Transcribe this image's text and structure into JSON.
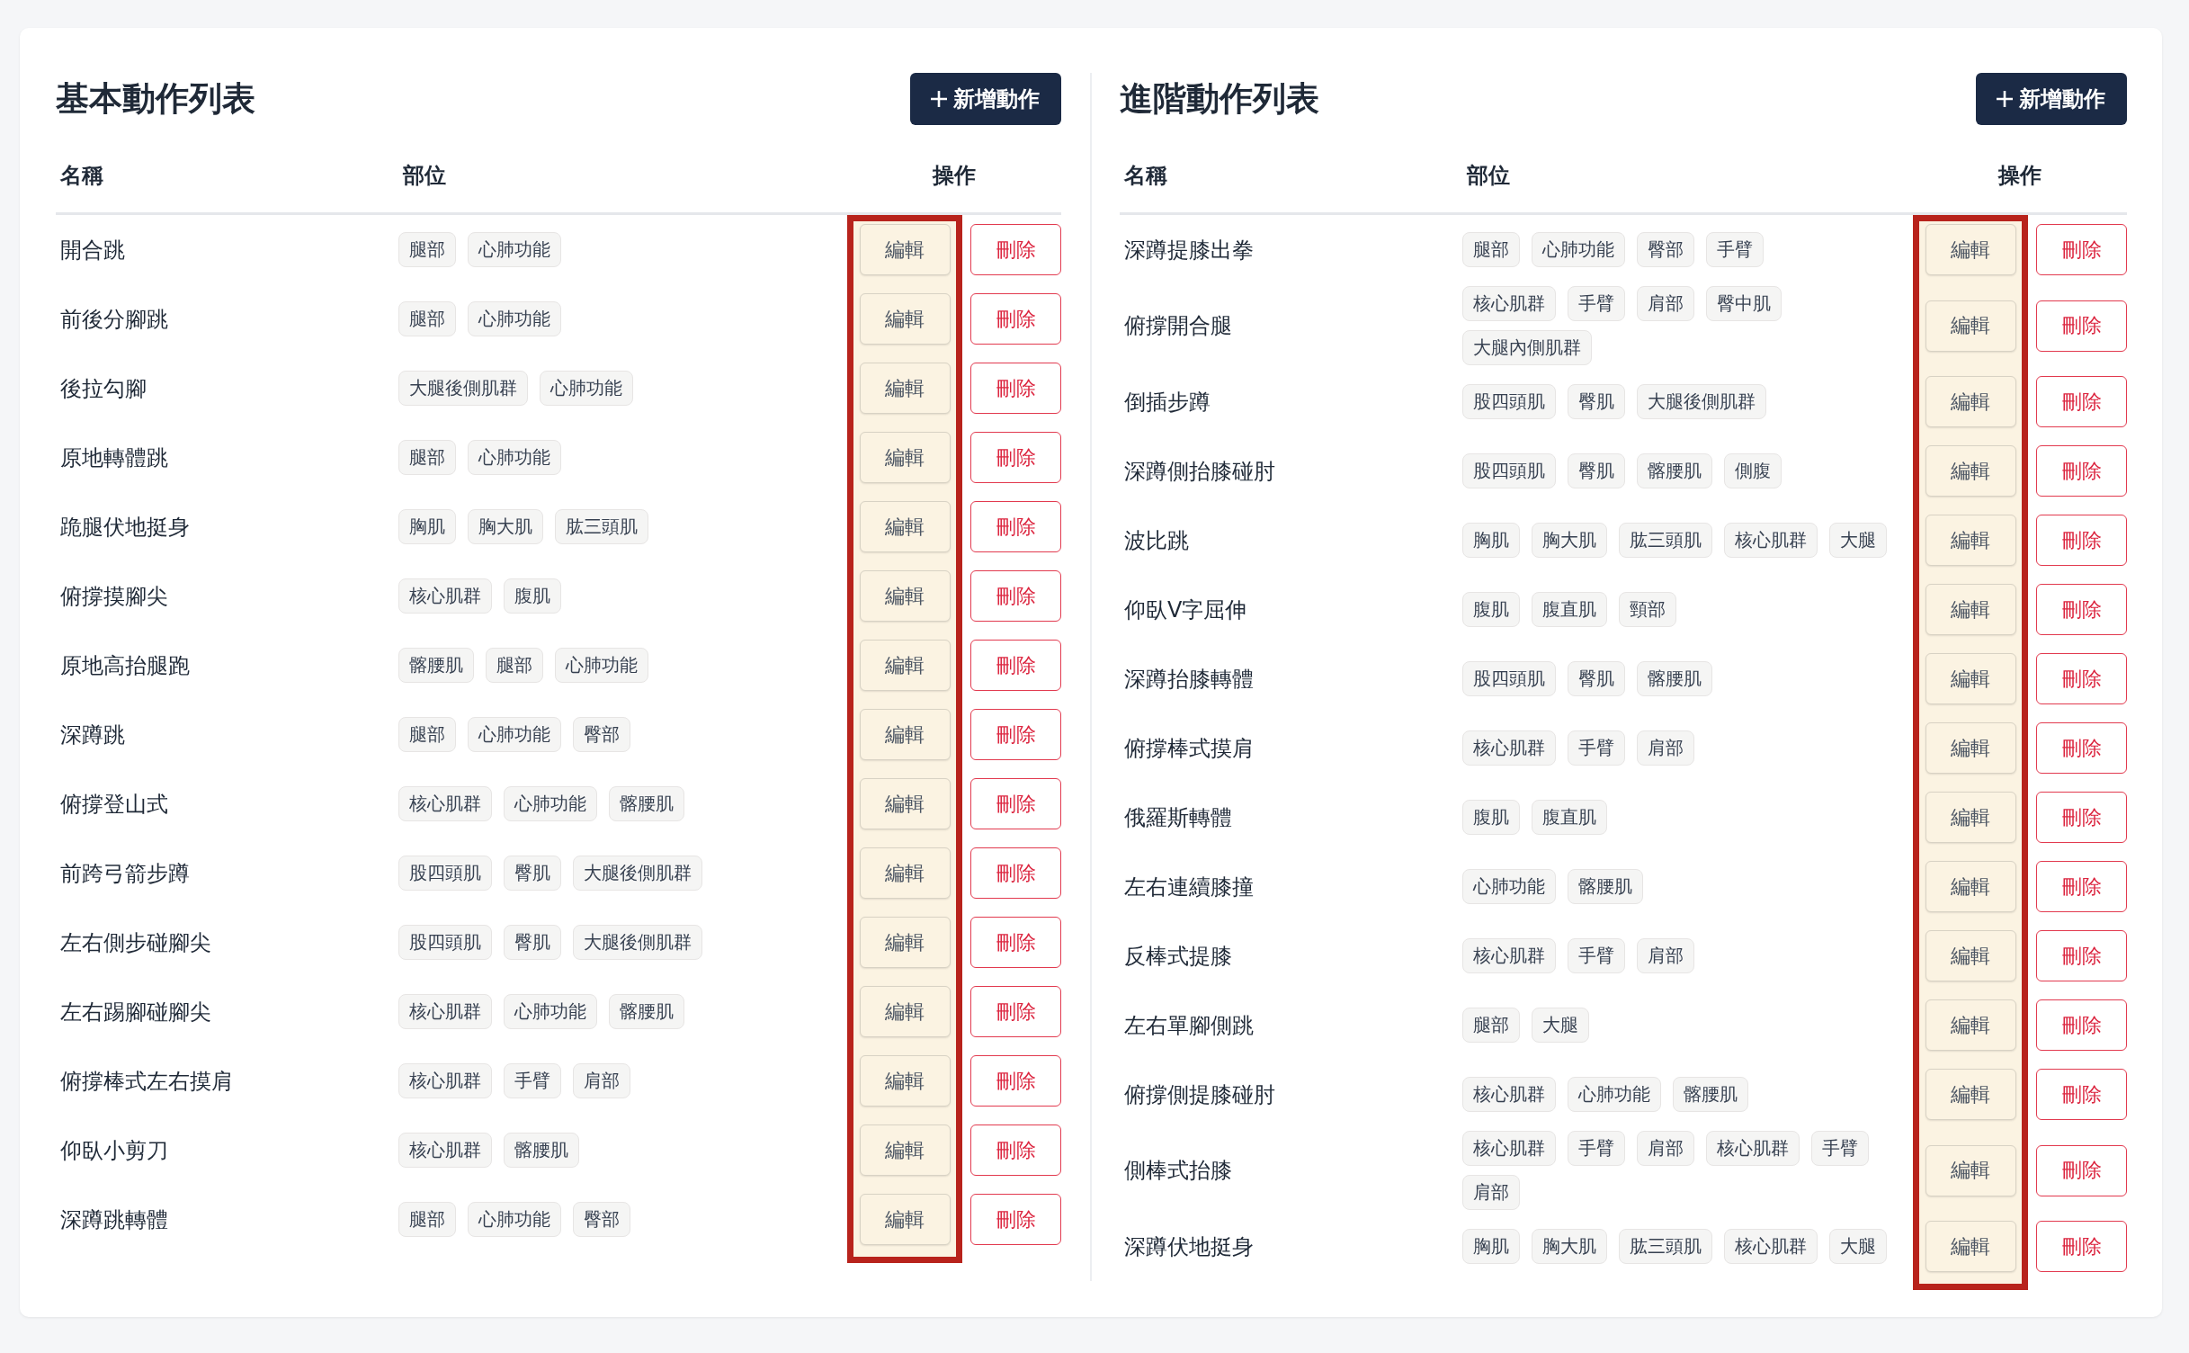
{
  "tables": [
    {
      "title": "基本動作列表",
      "add_button": "新增動作",
      "columns": [
        "名稱",
        "部位",
        "操作"
      ],
      "edit_column_highlighted": true,
      "rows": [
        {
          "name": "開合跳",
          "parts": [
            "腿部",
            "心肺功能"
          ],
          "edit": "編輯",
          "delete": "刪除"
        },
        {
          "name": "前後分腳跳",
          "parts": [
            "腿部",
            "心肺功能"
          ],
          "edit": "編輯",
          "delete": "刪除"
        },
        {
          "name": "後拉勾腳",
          "parts": [
            "大腿後側肌群",
            "心肺功能"
          ],
          "edit": "編輯",
          "delete": "刪除"
        },
        {
          "name": "原地轉體跳",
          "parts": [
            "腿部",
            "心肺功能"
          ],
          "edit": "編輯",
          "delete": "刪除"
        },
        {
          "name": "跪腿伏地挺身",
          "parts": [
            "胸肌",
            "胸大肌",
            "肱三頭肌"
          ],
          "edit": "編輯",
          "delete": "刪除"
        },
        {
          "name": "俯撐摸腳尖",
          "parts": [
            "核心肌群",
            "腹肌"
          ],
          "edit": "編輯",
          "delete": "刪除"
        },
        {
          "name": "原地高抬腿跑",
          "parts": [
            "髂腰肌",
            "腿部",
            "心肺功能"
          ],
          "edit": "編輯",
          "delete": "刪除"
        },
        {
          "name": "深蹲跳",
          "parts": [
            "腿部",
            "心肺功能",
            "臀部"
          ],
          "edit": "編輯",
          "delete": "刪除"
        },
        {
          "name": "俯撐登山式",
          "parts": [
            "核心肌群",
            "心肺功能",
            "髂腰肌"
          ],
          "edit": "編輯",
          "delete": "刪除"
        },
        {
          "name": "前跨弓箭步蹲",
          "parts": [
            "股四頭肌",
            "臀肌",
            "大腿後側肌群"
          ],
          "edit": "編輯",
          "delete": "刪除"
        },
        {
          "name": "左右側步碰腳尖",
          "parts": [
            "股四頭肌",
            "臀肌",
            "大腿後側肌群"
          ],
          "edit": "編輯",
          "delete": "刪除"
        },
        {
          "name": "左右踢腳碰腳尖",
          "parts": [
            "核心肌群",
            "心肺功能",
            "髂腰肌"
          ],
          "edit": "編輯",
          "delete": "刪除"
        },
        {
          "name": "俯撐棒式左右摸肩",
          "parts": [
            "核心肌群",
            "手臂",
            "肩部"
          ],
          "edit": "編輯",
          "delete": "刪除"
        },
        {
          "name": "仰臥小剪刀",
          "parts": [
            "核心肌群",
            "髂腰肌"
          ],
          "edit": "編輯",
          "delete": "刪除"
        },
        {
          "name": "深蹲跳轉體",
          "parts": [
            "腿部",
            "心肺功能",
            "臀部"
          ],
          "edit": "編輯",
          "delete": "刪除"
        }
      ]
    },
    {
      "title": "進階動作列表",
      "add_button": "新增動作",
      "columns": [
        "名稱",
        "部位",
        "操作"
      ],
      "edit_column_highlighted": true,
      "rows": [
        {
          "name": "深蹲提膝出拳",
          "parts": [
            "腿部",
            "心肺功能",
            "臀部",
            "手臂"
          ],
          "edit": "編輯",
          "delete": "刪除"
        },
        {
          "name": "俯撐開合腿",
          "parts": [
            "核心肌群",
            "手臂",
            "肩部",
            "臀中肌",
            "大腿內側肌群"
          ],
          "edit": "編輯",
          "delete": "刪除"
        },
        {
          "name": "倒插步蹲",
          "parts": [
            "股四頭肌",
            "臀肌",
            "大腿後側肌群"
          ],
          "edit": "編輯",
          "delete": "刪除"
        },
        {
          "name": "深蹲側抬膝碰肘",
          "parts": [
            "股四頭肌",
            "臀肌",
            "髂腰肌",
            "側腹"
          ],
          "edit": "編輯",
          "delete": "刪除"
        },
        {
          "name": "波比跳",
          "parts": [
            "胸肌",
            "胸大肌",
            "肱三頭肌",
            "核心肌群",
            "大腿"
          ],
          "edit": "編輯",
          "delete": "刪除"
        },
        {
          "name": "仰臥V字屈伸",
          "parts": [
            "腹肌",
            "腹直肌",
            "頸部"
          ],
          "edit": "編輯",
          "delete": "刪除"
        },
        {
          "name": "深蹲抬膝轉體",
          "parts": [
            "股四頭肌",
            "臀肌",
            "髂腰肌"
          ],
          "edit": "編輯",
          "delete": "刪除"
        },
        {
          "name": "俯撐棒式摸肩",
          "parts": [
            "核心肌群",
            "手臂",
            "肩部"
          ],
          "edit": "編輯",
          "delete": "刪除"
        },
        {
          "name": "俄羅斯轉體",
          "parts": [
            "腹肌",
            "腹直肌"
          ],
          "edit": "編輯",
          "delete": "刪除"
        },
        {
          "name": "左右連續膝撞",
          "parts": [
            "心肺功能",
            "髂腰肌"
          ],
          "edit": "編輯",
          "delete": "刪除"
        },
        {
          "name": "反棒式提膝",
          "parts": [
            "核心肌群",
            "手臂",
            "肩部"
          ],
          "edit": "編輯",
          "delete": "刪除"
        },
        {
          "name": "左右單腳側跳",
          "parts": [
            "腿部",
            "大腿"
          ],
          "edit": "編輯",
          "delete": "刪除"
        },
        {
          "name": "俯撐側提膝碰肘",
          "parts": [
            "核心肌群",
            "心肺功能",
            "髂腰肌"
          ],
          "edit": "編輯",
          "delete": "刪除"
        },
        {
          "name": "側棒式抬膝",
          "parts": [
            "核心肌群",
            "手臂",
            "肩部",
            "核心肌群",
            "手臂",
            "肩部"
          ],
          "edit": "編輯",
          "delete": "刪除"
        },
        {
          "name": "深蹲伏地挺身",
          "parts": [
            "胸肌",
            "胸大肌",
            "肱三頭肌",
            "核心肌群",
            "大腿"
          ],
          "edit": "編輯",
          "delete": "刪除"
        }
      ]
    }
  ]
}
